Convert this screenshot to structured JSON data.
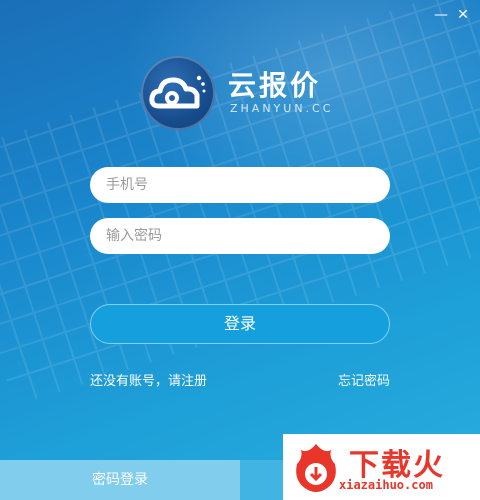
{
  "window": {
    "minimize_symbol": "—",
    "close_symbol": "✕"
  },
  "brand": {
    "name": "云报价",
    "subtitle": "ZHANYUN.CC",
    "logo_icon": "cloud-icon"
  },
  "form": {
    "phone_placeholder": "手机号",
    "password_placeholder": "输入密码",
    "login_label": "登录"
  },
  "links": {
    "register": "还没有账号，请注册",
    "forgot": "忘记密码"
  },
  "bottom_tabs": {
    "password_login": "密码登录"
  },
  "watermark": {
    "text": "下载火",
    "url": "xiazaihuo.com"
  },
  "colors": {
    "accent": "#15a0dd",
    "background": "#1a86cc",
    "watermark": "#e8362a"
  }
}
